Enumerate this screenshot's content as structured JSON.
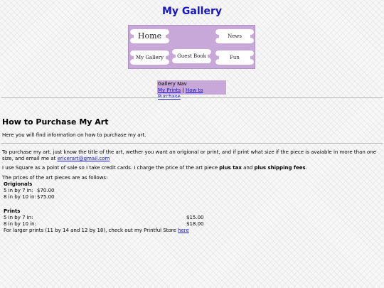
{
  "site": {
    "title": "My Gallery"
  },
  "nav": {
    "home": "Home",
    "news": "News",
    "my_gallery": "My Gallery",
    "guest_book": "Guest Book",
    "fun": "Fun"
  },
  "gallery_nav": {
    "title": "Gallery Nav",
    "prints_link": "My Prints",
    "separator": "|",
    "purchase_link": "How to Purchase"
  },
  "main": {
    "heading": "How to Purchase My Art",
    "intro": "Here you will find information on how to purchase my art.",
    "purchase_text": "To purchase my art, just know the title of the art, wether you want an origional or print, and if print what size if the piece is avaiable in more than one size, and email me at",
    "email": "ericerart@gmail.com",
    "square_text_1": "I use Square as a point of sale so I take credit cards. I charge the price of the art piece",
    "plus_tax": "plus tax",
    "and_text": "and",
    "plus_shipping": "plus shipping fees",
    "period": ".",
    "prices_intro": "The prices of the art pieces are as follows:"
  },
  "originals": {
    "heading": "Origionals",
    "rows": [
      {
        "size": "5 in by 7 in:",
        "price": "$70.00"
      },
      {
        "size": "8 in by 10 in:",
        "price": "$75.00"
      }
    ]
  },
  "prints": {
    "heading": "Prints",
    "rows": [
      {
        "size": "5 in by 7 in:",
        "price": "$15.00"
      },
      {
        "size": "8 in by 10 in:",
        "price": "$18.00"
      }
    ],
    "larger_text": "For larger prints (11 by 14 and 12 by 18), check out my Printful Store",
    "here_link": "here"
  }
}
